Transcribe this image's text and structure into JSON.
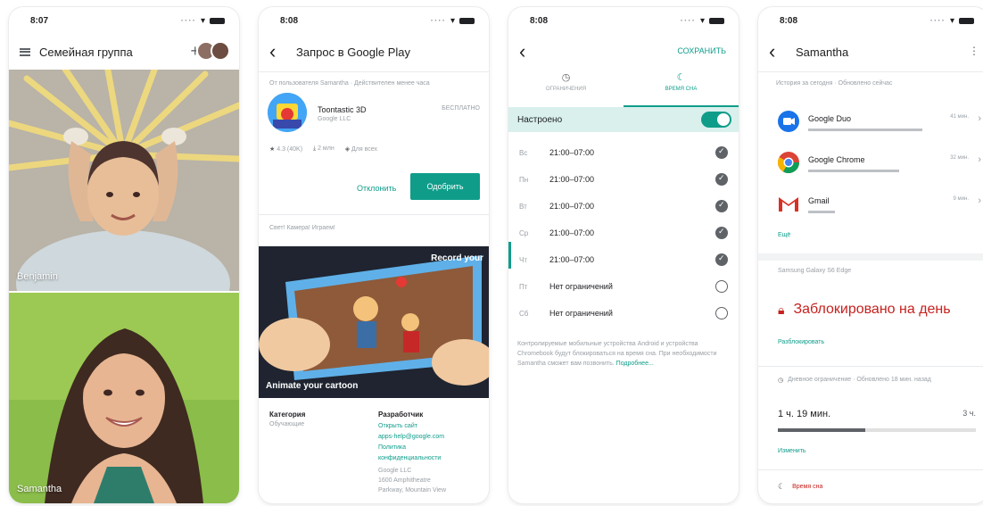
{
  "screens": [
    {
      "time": "8:07",
      "title": "Семейная группа",
      "members": [
        {
          "name": "Benjamin"
        },
        {
          "name": "Samantha"
        }
      ]
    },
    {
      "time": "8:08",
      "title": "Запрос в Google Play",
      "request_note": "От пользователя Samantha · Действителен менее часа",
      "app_name": "Toontastic 3D",
      "developer": "Google LLC",
      "price": "БЕСПЛАТНО",
      "rating": "4.3 (40K)",
      "downloads": "2 млн",
      "age": "Для всех",
      "decline_label": "Отклонить",
      "approve_label": "Одобрить",
      "tagline": "Свет! Камера! Играем!",
      "banner_top": "Record your",
      "banner_bottom": "Animate your cartoon",
      "category_label": "Категория",
      "category_value": "Обучающие",
      "developer_label": "Разработчик",
      "developer_links": [
        "Открыть сайт",
        "apps-help@google.com",
        "Политика",
        "конфиденциальности"
      ],
      "address": [
        "Google LLC",
        "1600 Amphitheatre",
        "Parkway, Mountain View"
      ]
    },
    {
      "time": "8:08",
      "save_label": "СОХРАНИТЬ",
      "tabs": [
        "ОГРАНИЧЕНИЯ",
        "ВРЕМЯ СНА"
      ],
      "configured_label": "Настроено",
      "days": [
        {
          "day": "Вс",
          "time": "21:00–07:00",
          "checked": true
        },
        {
          "day": "Пн",
          "time": "21:00–07:00",
          "checked": true
        },
        {
          "day": "Вт",
          "time": "21:00–07:00",
          "checked": true
        },
        {
          "day": "Ср",
          "time": "21:00–07:00",
          "checked": true
        },
        {
          "day": "Чт",
          "time": "21:00–07:00",
          "checked": true
        },
        {
          "day": "Пт",
          "time": "Нет ограничений",
          "checked": false
        },
        {
          "day": "Сб",
          "time": "Нет ограничений",
          "checked": false
        }
      ],
      "footnote": "Контролируемые мобильные устройства Android и устройства Chromebook будут блокироваться на время сна. При необходимости Samantha сможет вам позвонить.",
      "more_link": "Подробнее..."
    },
    {
      "time": "8:08",
      "title": "Samantha",
      "history_header": "История за сегодня · Обновлено сейчас",
      "apps": [
        {
          "name": "Google Duo",
          "duration": "41 мин.",
          "bar": 0.85
        },
        {
          "name": "Google Chrome",
          "duration": "32 мин.",
          "bar": 0.68
        },
        {
          "name": "Gmail",
          "duration": "9 мин.",
          "bar": 0.2
        }
      ],
      "more_apps": "Ещё",
      "device": "Samsung Galaxy S6 Edge",
      "locked_label": "Заблокировано на день",
      "unlock_label": "Разблокировать",
      "daily_limit_header": "Дневное ограничение · Обновлено 18 мин. назад",
      "used": "1 ч. 19 мин.",
      "limit": "3 ч.",
      "used_fraction": 0.44,
      "change_label": "Изменить",
      "sleep_label": "Время сна"
    }
  ],
  "colors": {
    "accent": "#0f9d8a",
    "locked": "#c5221f"
  }
}
